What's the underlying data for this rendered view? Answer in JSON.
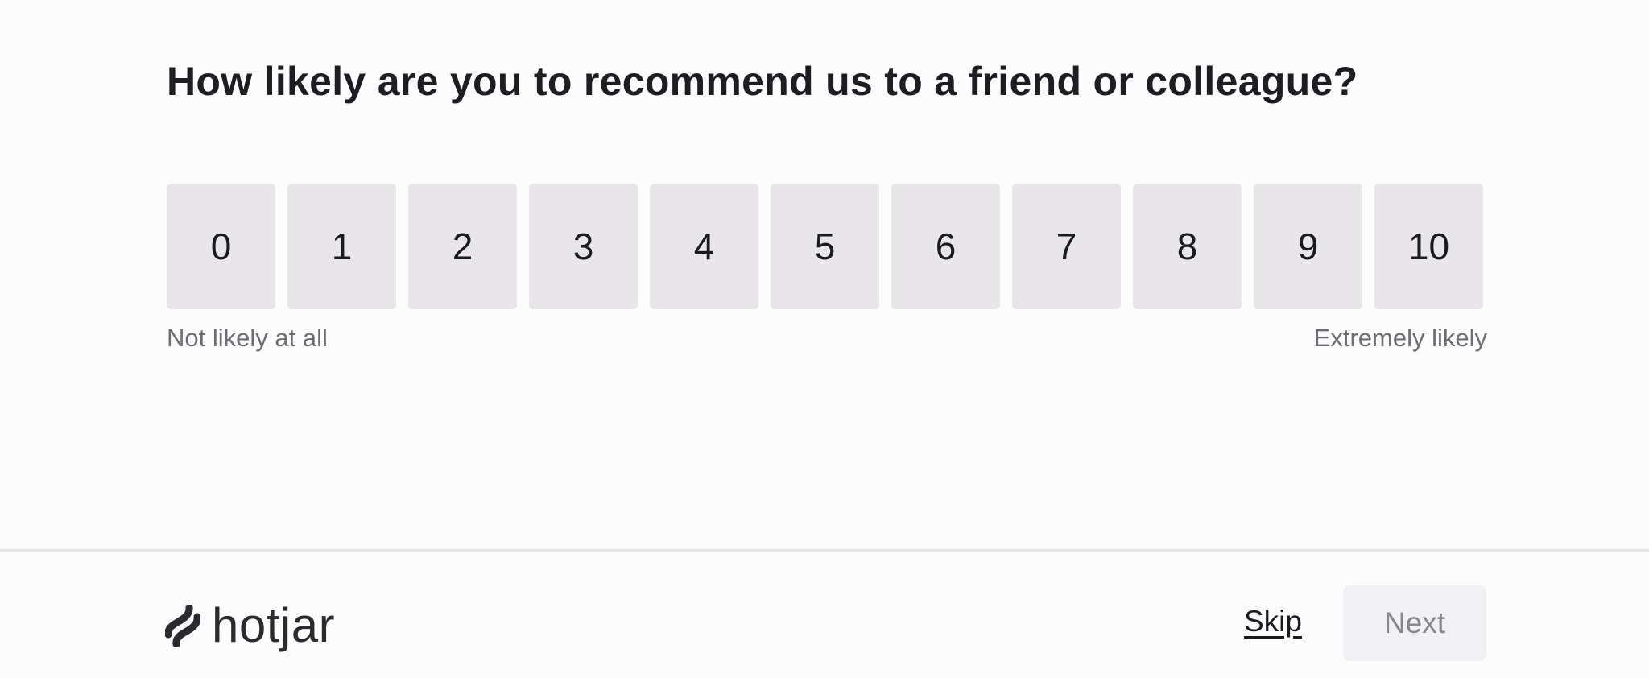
{
  "survey": {
    "question": "How likely are you to recommend us to a friend or colleague?",
    "scale": [
      "0",
      "1",
      "2",
      "3",
      "4",
      "5",
      "6",
      "7",
      "8",
      "9",
      "10"
    ],
    "low_label": "Not likely at all",
    "high_label": "Extremely likely"
  },
  "footer": {
    "brand": "hotjar",
    "brand_icon": "hotjar-logo-icon",
    "skip_label": "Skip",
    "next_label": "Next"
  },
  "colors": {
    "background": "#fdfcfd",
    "score_button": "#e8e6e9",
    "next_button_disabled": "#f1f0f4"
  }
}
